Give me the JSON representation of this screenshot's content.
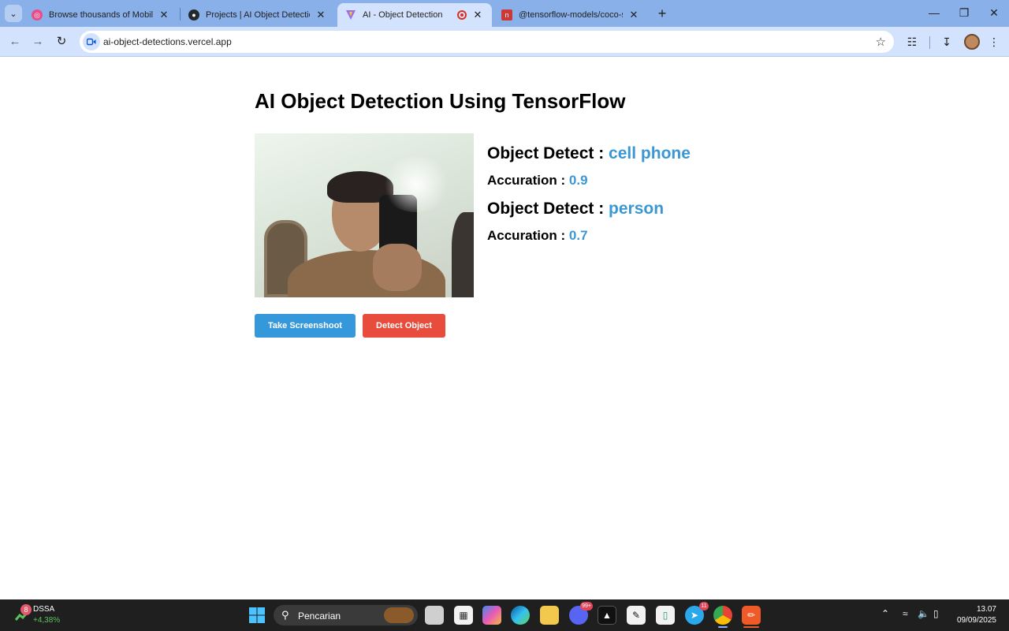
{
  "browser": {
    "tabs": [
      {
        "title": "Browse thousands of Mobile Co",
        "favicon": "dribbble-icon",
        "active": false
      },
      {
        "title": "Projects | AI Object Detection |",
        "favicon": "github-icon",
        "active": false
      },
      {
        "title": "AI - Object Detection",
        "favicon": "vite-icon",
        "active": true,
        "recording": true
      },
      {
        "title": "@tensorflow-models/coco-ssd",
        "favicon": "npm-icon",
        "active": false
      }
    ],
    "url": "ai-object-detections.vercel.app"
  },
  "page": {
    "title": "AI Object Detection Using TensorFlow",
    "detections": [
      {
        "label_prefix": "Object Detect : ",
        "object": "cell phone",
        "acc_prefix": "Accuration : ",
        "accuracy": "0.9"
      },
      {
        "label_prefix": "Object Detect : ",
        "object": "person",
        "acc_prefix": "Accuration : ",
        "accuracy": "0.7"
      }
    ],
    "buttons": {
      "screenshot": "Take Screenshoot",
      "detect": "Detect Object"
    }
  },
  "taskbar": {
    "stock": {
      "badge": "8",
      "name": "DSSA",
      "change": "+4,38%"
    },
    "search_placeholder": "Pencarian",
    "badges": {
      "discord": "99+",
      "telegram": "11"
    },
    "time": "13.07",
    "date": "09/09/2025"
  },
  "colors": {
    "accent_blue": "#3498db",
    "accent_red": "#e74c3c",
    "value_blue": "#3a97d4",
    "tabstrip": "#89b0e9",
    "toolbar": "#d3e3fd"
  }
}
